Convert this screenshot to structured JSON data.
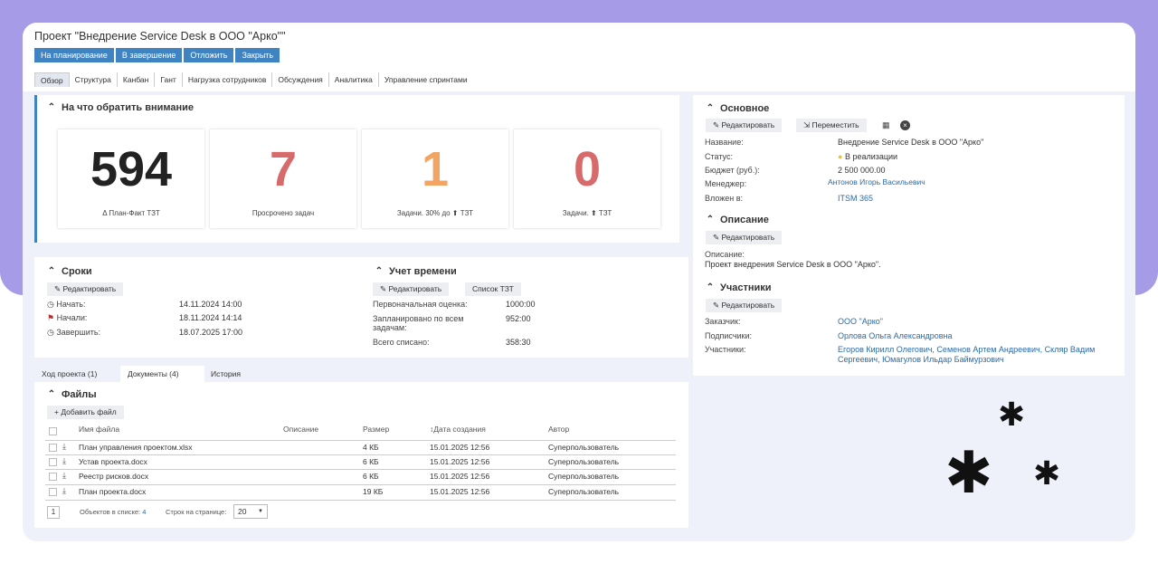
{
  "project_title": "Проект \"Внедрение Service Desk в ООО \"Арко\"\"",
  "actions": [
    "На планирование",
    "В завершение",
    "Отложить",
    "Закрыть"
  ],
  "tabs": [
    "Обзор",
    "Структура",
    "Канбан",
    "Гант",
    "Нагрузка сотрудников",
    "Обсуждения",
    "Аналитика",
    "Управление спринтами"
  ],
  "attention": {
    "title": "На что обратить внимание",
    "tiles": [
      {
        "value": "594",
        "label": "Δ План-Факт ТЗТ",
        "color": "#222222"
      },
      {
        "value": "7",
        "label": "Просрочено задач",
        "color": "#d76a6a"
      },
      {
        "value": "1",
        "label": "Задачи. 30% до ⬆ ТЗТ",
        "color": "#f2a464"
      },
      {
        "value": "0",
        "label": "Задачи. ⬆ ТЗТ",
        "color": "#d76a6a"
      }
    ]
  },
  "terms": {
    "title": "Сроки",
    "edit": "Редактировать",
    "rows": [
      {
        "label": "Начать:",
        "value": "14.11.2024 14:00"
      },
      {
        "label": "Начали:",
        "value": "18.11.2024 14:14"
      },
      {
        "label": "Завершить:",
        "value": "18.07.2025 17:00"
      }
    ]
  },
  "time": {
    "title": "Учет времени",
    "edit": "Редактировать",
    "list": "Список ТЗТ",
    "rows": [
      {
        "label": "Первоначальная оценка:",
        "value": "1000:00"
      },
      {
        "label": "Запланировано по всем задачам:",
        "value": "952:00"
      },
      {
        "label": "Всего списано:",
        "value": "358:30"
      }
    ]
  },
  "subtabs": [
    "Ход проекта (1)",
    "Документы (4)",
    "История"
  ],
  "files": {
    "title": "Файлы",
    "add": "Добавить файл",
    "columns": [
      "Имя файла",
      "Описание",
      "Размер",
      "Дата создания",
      "Автор"
    ],
    "rows": [
      {
        "name": "План управления проектом.xlsx",
        "size": "4 КБ",
        "date": "15.01.2025 12:56",
        "author": "Суперпользователь"
      },
      {
        "name": "Устав проекта.docx",
        "size": "6 КБ",
        "date": "15.01.2025 12:56",
        "author": "Суперпользователь"
      },
      {
        "name": "Реестр рисков.docx",
        "size": "6 КБ",
        "date": "15.01.2025 12:56",
        "author": "Суперпользователь"
      },
      {
        "name": "План проекта.docx",
        "size": "19 КБ",
        "date": "15.01.2025 12:56",
        "author": "Суперпользователь"
      }
    ],
    "page": "1",
    "count_label": "Объектов в списке:",
    "count": "4",
    "per_page_label": "Строк на странице:",
    "per_page": "20"
  },
  "main": {
    "title": "Основное",
    "edit": "Редактировать",
    "move": "Переместить",
    "fields": [
      {
        "label": "Название:",
        "value": "Внедрение Service Desk в ООО \"Арко\""
      },
      {
        "label": "Статус:",
        "value": "В реализации"
      },
      {
        "label": "Бюджет (руб.):",
        "value": "2 500 000.00"
      },
      {
        "label": "Менеджер:",
        "value": "Антонов Игорь Васильевич"
      },
      {
        "label": "Вложен в:",
        "value": "ITSM 365"
      }
    ]
  },
  "description": {
    "title": "Описание",
    "edit": "Редактировать",
    "label": "Описание:",
    "text": "Проект внедрения Service Desk в ООО \"Арко\"."
  },
  "participants": {
    "title": "Участники",
    "edit": "Редактировать",
    "customer_label": "Заказчик:",
    "customer": "ООО \"Арко\"",
    "subscribers_label": "Подписчики:",
    "subscribers": "Орлова Ольга Александровна",
    "members_label": "Участники:",
    "members_line1": "Егоров Кирилл Олегович, Семенов Артем Андреевич, Скляр Вадим",
    "members_line2": "Сергеевич, Юмагулов Ильдар Баймурзович"
  },
  "colors": {
    "accent": "#3f83c2",
    "purple": "#a69be6",
    "link": "#2a6aa8"
  }
}
